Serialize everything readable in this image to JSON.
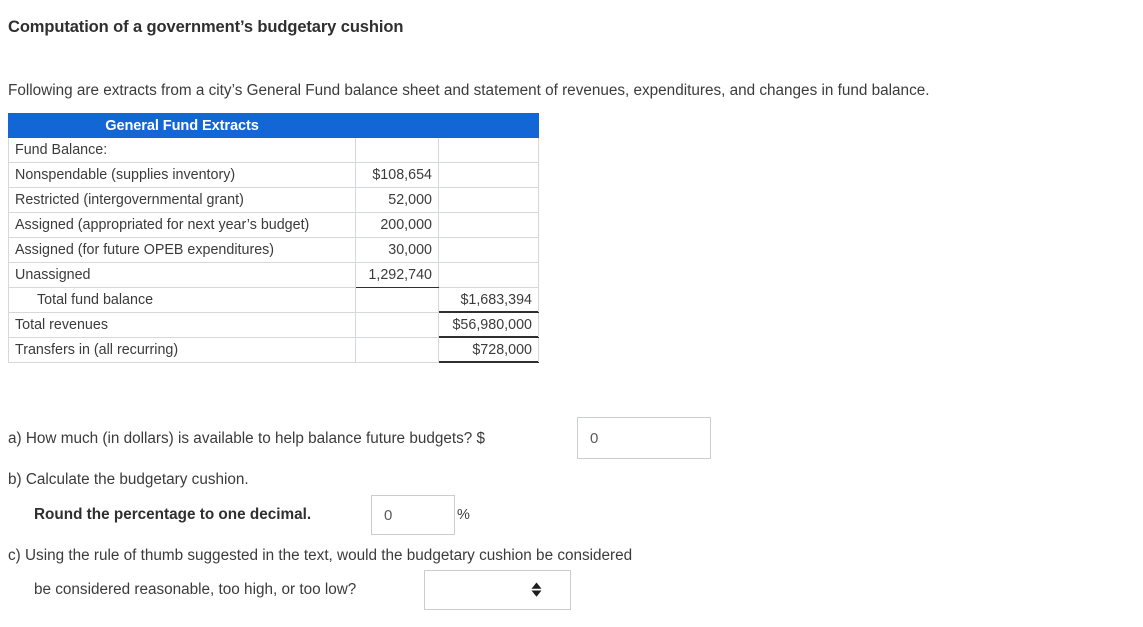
{
  "page_title": "Computation of a government’s budgetary cushion",
  "intro": "Following are extracts from a city’s General Fund balance sheet and statement of revenues, expenditures, and changes in fund balance.",
  "table": {
    "header": "General Fund Extracts",
    "rows": [
      {
        "label": "Fund Balance:",
        "amount1": "",
        "amount2": ""
      },
      {
        "label": "Nonspendable (supplies inventory)",
        "amount1": "$108,654",
        "amount2": ""
      },
      {
        "label": "Restricted (intergovernmental grant)",
        "amount1": "52,000",
        "amount2": ""
      },
      {
        "label": "Assigned (appropriated for next year’s budget)",
        "amount1": "200,000",
        "amount2": ""
      },
      {
        "label": "Assigned (for future OPEB expenditures)",
        "amount1": "30,000",
        "amount2": ""
      },
      {
        "label": "Unassigned",
        "amount1": "1,292,740",
        "amount2": ""
      },
      {
        "label": "Total fund balance",
        "amount1": "",
        "amount2": "$1,683,394"
      },
      {
        "label": "Total revenues",
        "amount1": "",
        "amount2": "$56,980,000"
      },
      {
        "label": "Transfers in (all recurring)",
        "amount1": "",
        "amount2": "$728,000"
      }
    ]
  },
  "questions": {
    "a_text": "a) How much (in dollars) is available to help balance future budgets? $",
    "a_dollar_sign": "$",
    "a_value": "0",
    "b_text": "b) Calculate the budgetary cushion.",
    "b_round_instruction": "Round the percentage to one decimal.",
    "b_value": "0",
    "b_percent_sign": "%",
    "c_text_line1": "c) Using the rule of thumb suggested in the text, would the budgetary cushion be considered",
    "c_text_line2": "be considered reasonable, too high, or too low?",
    "c_selected": ""
  },
  "colors": {
    "header_blue": "#1266d6",
    "text": "#3b3b3b",
    "border": "#d6d9dc",
    "input_border": "#c9ccd0"
  }
}
